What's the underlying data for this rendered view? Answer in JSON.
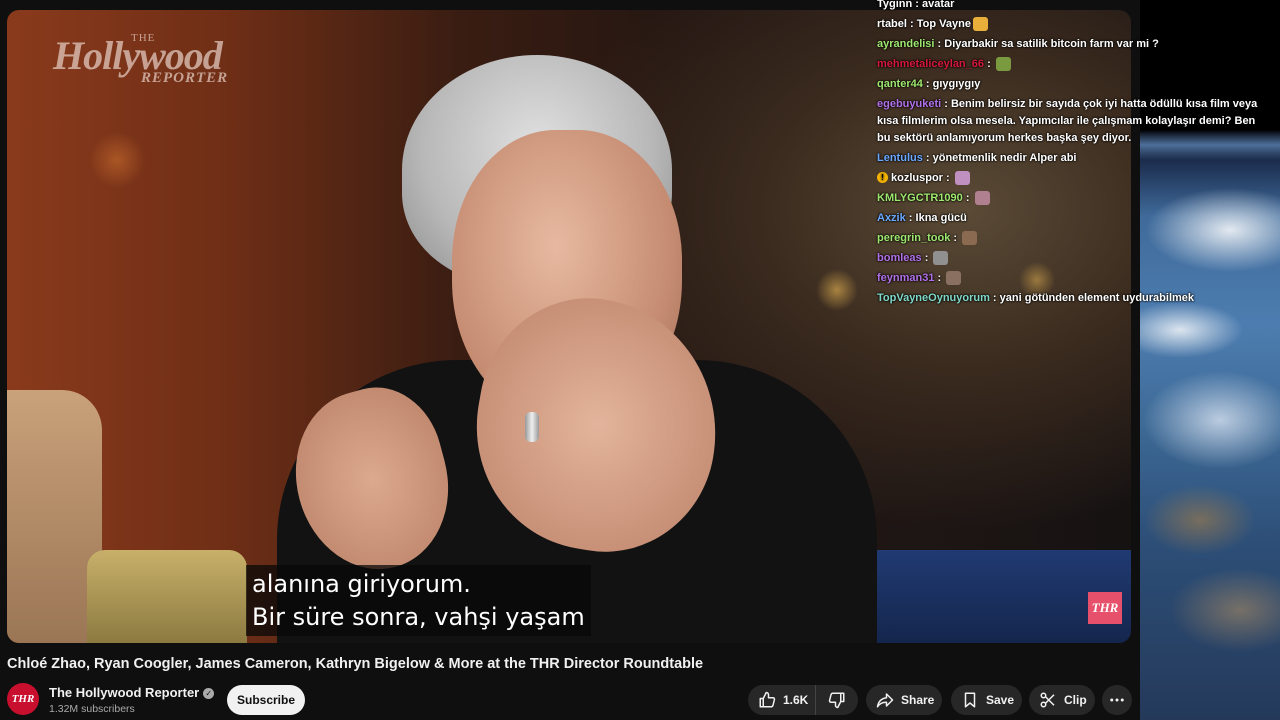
{
  "video": {
    "watermark": {
      "the": "THE",
      "name": "Hollywood",
      "sub": "REPORTER"
    },
    "corner_badge": "THR",
    "subtitle_lines": [
      "alanına giriyorum.",
      "Bir süre sonra, vahşi yaşam"
    ]
  },
  "chat": {
    "messages": [
      {
        "user": "Tyginn",
        "color": "#ffffff",
        "text": "avatar"
      },
      {
        "user": "rtabel",
        "color": "#ffffff",
        "text": "Top Vayne",
        "emote": "#e8b03a"
      },
      {
        "user": "ayrandelisi",
        "color": "#9fe870",
        "text": "Diyarbakir sa satilik bitcoin farm var mi ?"
      },
      {
        "user": "mehmetaliceylan_66",
        "color": "#d4183b",
        "text": "",
        "emote": "#7a9a40"
      },
      {
        "user": "qanter44",
        "color": "#9fe870",
        "text": "gıygıygıy"
      },
      {
        "user": "egebuyuketi",
        "color": "#b070e8",
        "text": "Benim belirsiz bir sayıda çok iyi hatta ödüllü kısa film veya kısa filmlerim olsa mesela. Yapımcılar ile çalışmam kolaylaşır demi? Ben bu sektörü anlamıyorum herkes başka şey diyor."
      },
      {
        "user": "Lentulus",
        "color": "#6aa8ff",
        "text": "yönetmenlik nedir Alper abi"
      },
      {
        "user": "kozluspor",
        "color": "#ffffff",
        "text": "",
        "emote": "#c090c0",
        "badge": true
      },
      {
        "user": "KMLYGCTR1090",
        "color": "#9fe870",
        "text": "",
        "emote": "#b08090"
      },
      {
        "user": "Axzik",
        "color": "#6aa8ff",
        "text": "Ikna gücü"
      },
      {
        "user": "peregrin_took",
        "color": "#9fe870",
        "text": "",
        "emote": "#8a6a50"
      },
      {
        "user": "bomleas",
        "color": "#b070e8",
        "text": "",
        "emote": "#909090"
      },
      {
        "user": "feynman31",
        "color": "#b070e8",
        "text": "",
        "emote": "#8a7060"
      },
      {
        "user": "TopVayneOynuyorum",
        "color": "#7ed8c8",
        "text": "yani götünden element uydurabilmek"
      }
    ]
  },
  "info": {
    "title": "Chloé Zhao, Ryan Coogler, James Cameron, Kathryn Bigelow & More at the THR Director Roundtable",
    "channel_avatar": "THR",
    "channel_name": "The Hollywood Reporter",
    "subscribers": "1.32M subscribers",
    "subscribe_label": "Subscribe",
    "like_count": "1.6K",
    "share_label": "Share",
    "save_label": "Save",
    "clip_label": "Clip"
  }
}
